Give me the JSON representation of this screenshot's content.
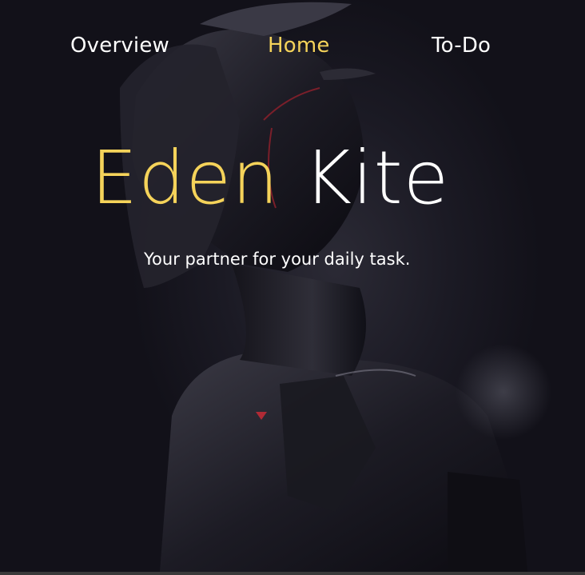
{
  "nav": {
    "items": [
      {
        "label": "Overview",
        "active": false
      },
      {
        "label": "Home",
        "active": true
      },
      {
        "label": "To-Do",
        "active": false
      }
    ]
  },
  "hero": {
    "title_first": "Eden",
    "title_last": "Kite",
    "tagline": "Your partner for your daily task."
  },
  "colors": {
    "accent": "#f5d35a",
    "text": "#ffffff",
    "background": "#121119"
  },
  "background_image": "robot-helmet-illustration"
}
